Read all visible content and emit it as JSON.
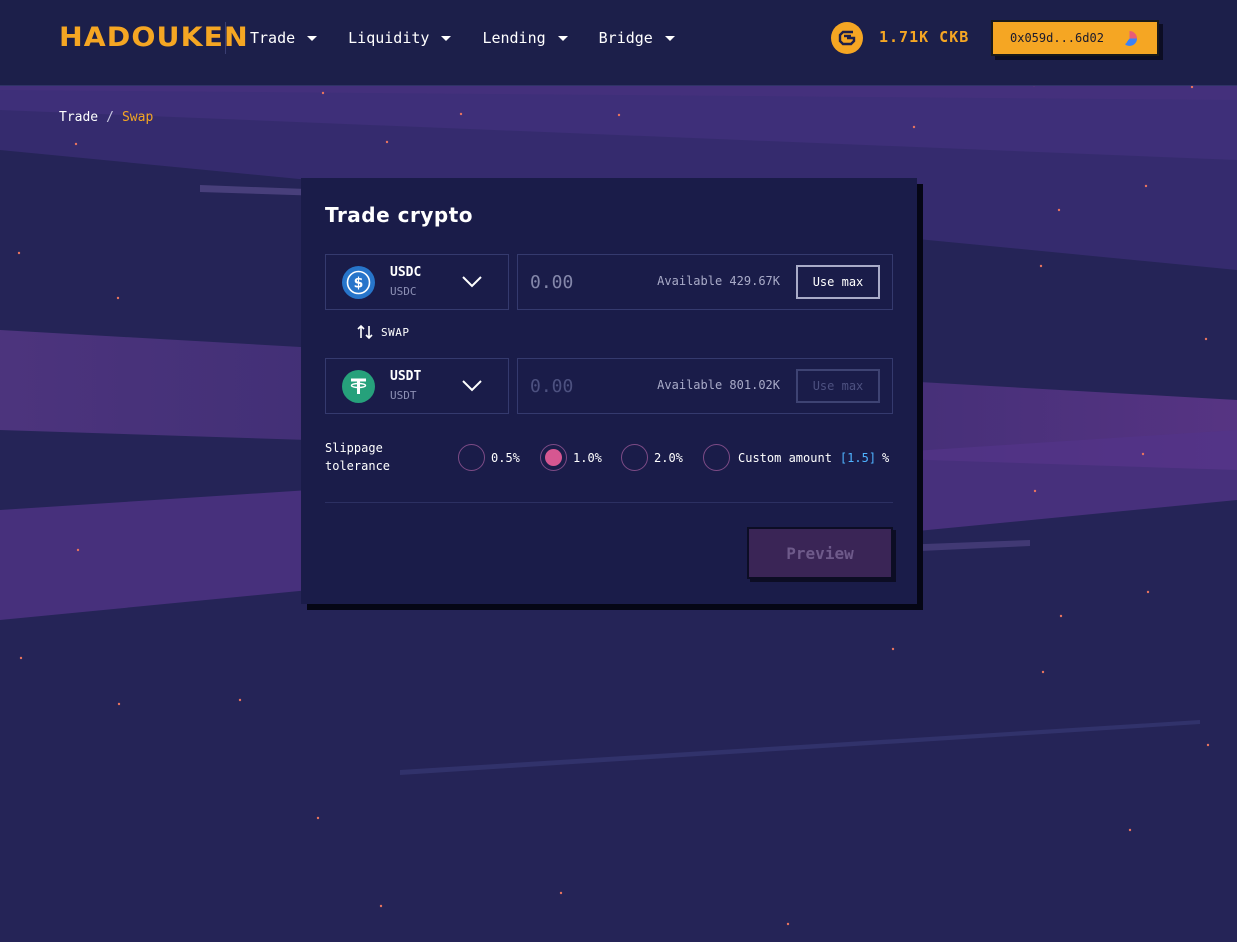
{
  "header": {
    "logo_text": "HADOUKEN",
    "nav": [
      {
        "label": "Trade"
      },
      {
        "label": "Liquidity"
      },
      {
        "label": "Lending"
      },
      {
        "label": "Bridge"
      }
    ],
    "balance": "1.71K CKB",
    "wallet_address": "0x059d...6d02"
  },
  "breadcrumb": {
    "parent": "Trade",
    "separator": "/",
    "current": "Swap"
  },
  "card": {
    "title": "Trade crypto",
    "from": {
      "symbol": "USDC",
      "name": "USDC",
      "icon": "usdc-icon",
      "amount_placeholder": "0.00",
      "available": "Available 429.67K",
      "use_max": "Use max"
    },
    "swap_label": "SWAP",
    "to": {
      "symbol": "USDT",
      "name": "USDT",
      "icon": "usdt-icon",
      "amount_placeholder": "0.00",
      "available": "Available 801.02K",
      "use_max": "Use max"
    },
    "slippage": {
      "label": "Slippage tolerance",
      "options": [
        "0.5%",
        "1.0%",
        "2.0%"
      ],
      "selected": "1.0%",
      "custom_label": "Custom amount",
      "custom_value": "[1.5]",
      "custom_unit": "%"
    },
    "preview_label": "Preview"
  },
  "colors": {
    "accent": "#f5a623",
    "background": "#252457",
    "card": "#1a1c49",
    "radio_selected": "#d65791",
    "custom_value": "#4fb3ff"
  }
}
